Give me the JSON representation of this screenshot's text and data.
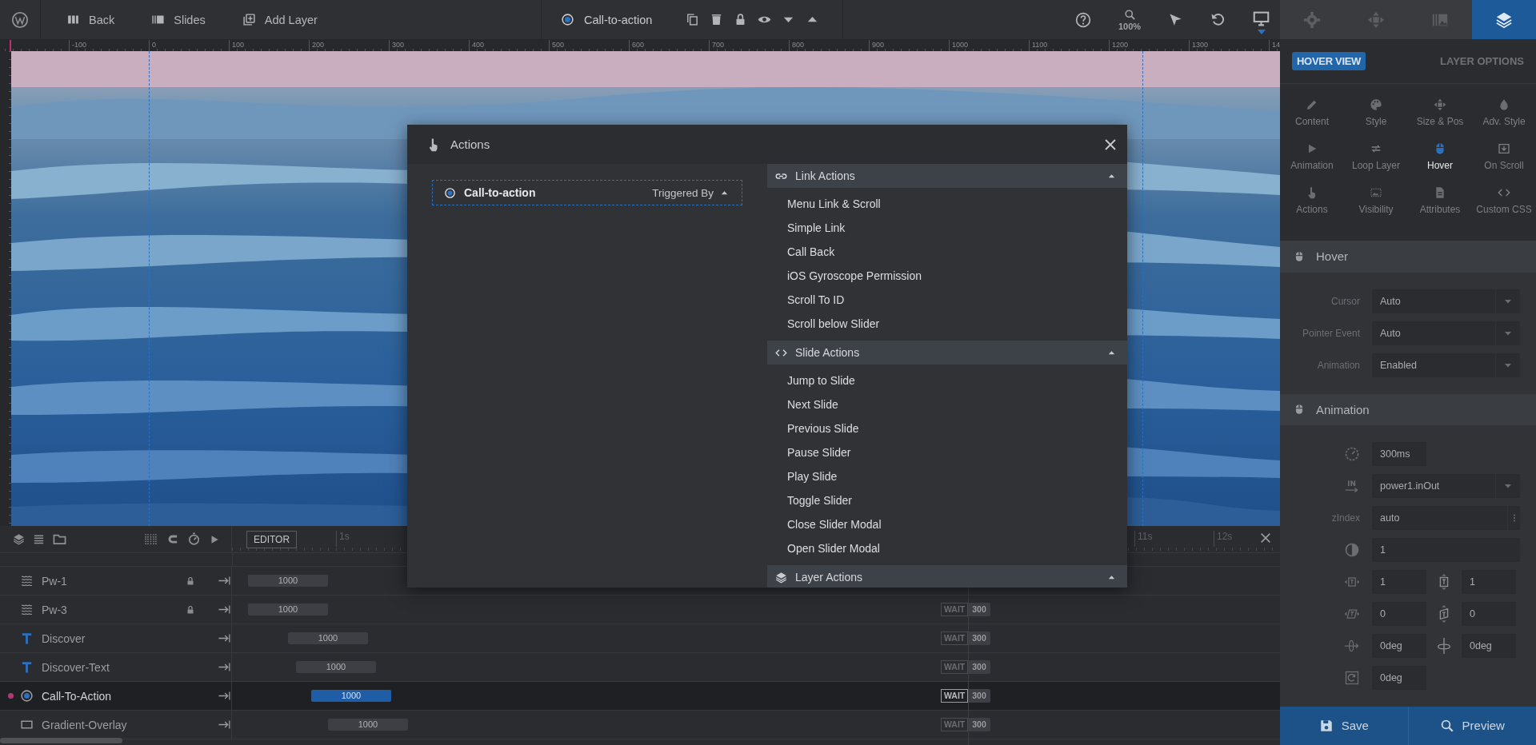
{
  "toolbar": {
    "nav": [
      {
        "label": "Back"
      },
      {
        "label": "Slides"
      },
      {
        "label": "Add Layer"
      }
    ],
    "layer": {
      "label": "Call-to-action"
    },
    "zoom": "100%"
  },
  "ruler": [
    "-100",
    "0",
    "100",
    "200",
    "300",
    "400",
    "500",
    "600",
    "700",
    "800",
    "900",
    "1000",
    "1100",
    "1200",
    "1300",
    "14"
  ],
  "modal": {
    "title": "Actions",
    "trigger": {
      "label": "Call-to-action",
      "button": "Triggered By",
      "expanded": true
    },
    "groups": [
      {
        "title": "Link Actions",
        "expanded": true,
        "items": [
          "Menu Link & Scroll",
          "Simple Link",
          "Call Back",
          "iOS Gyroscope Permission",
          "Scroll To ID",
          "Scroll below Slider"
        ]
      },
      {
        "title": "Slide Actions",
        "expanded": true,
        "items": [
          "Jump to Slide",
          "Next Slide",
          "Previous Slide",
          "Pause Slider",
          "Play Slide",
          "Toggle Slider",
          "Close Slider Modal",
          "Open Slider Modal"
        ]
      },
      {
        "title": "Layer Actions",
        "expanded": true
      }
    ]
  },
  "timeline": {
    "mode": "EDITOR",
    "ticks": [
      "1s",
      "11s",
      "12s"
    ],
    "layers": [
      {
        "name": "Pw-1",
        "kind": "waves",
        "locked": true,
        "selected": false,
        "bar": "1000"
      },
      {
        "name": "Pw-3",
        "kind": "waves",
        "locked": true,
        "selected": false,
        "bar": "1000",
        "wait": {
          "label": "WAIT",
          "value": "300"
        }
      },
      {
        "name": "Discover",
        "kind": "text",
        "locked": false,
        "selected": false,
        "bar": "1000",
        "wait": {
          "label": "WAIT",
          "value": "300"
        }
      },
      {
        "name": "Discover-Text",
        "kind": "text",
        "locked": false,
        "selected": false,
        "bar": "1000",
        "wait": {
          "label": "WAIT",
          "value": "300"
        }
      },
      {
        "name": "Call-To-Action",
        "kind": "button",
        "locked": false,
        "selected": true,
        "bar": "1000",
        "wait": {
          "label": "WAIT",
          "value": "300"
        }
      },
      {
        "name": "Gradient-Overlay",
        "kind": "box",
        "locked": false,
        "selected": false,
        "bar": "1000",
        "wait": {
          "label": "WAIT",
          "value": "300"
        }
      }
    ]
  },
  "panel": {
    "tabs": [
      {
        "selected": false
      },
      {
        "selected": false
      },
      {
        "selected": false
      },
      {
        "selected": true
      }
    ],
    "view_badge": "HOVER VIEW",
    "heading": "LAYER OPTIONS",
    "options": [
      {
        "label": "Content",
        "selected": false
      },
      {
        "label": "Style",
        "selected": false
      },
      {
        "label": "Size & Pos",
        "selected": false
      },
      {
        "label": "Adv. Style",
        "selected": false
      },
      {
        "label": "Animation",
        "selected": false
      },
      {
        "label": "Loop Layer",
        "selected": false
      },
      {
        "label": "Hover",
        "selected": true
      },
      {
        "label": "On Scroll",
        "selected": false
      },
      {
        "label": "Actions",
        "selected": false
      },
      {
        "label": "Visibility",
        "selected": false
      },
      {
        "label": "Attributes",
        "selected": false
      },
      {
        "label": "Custom CSS",
        "selected": false
      }
    ],
    "sections": [
      {
        "title": "Hover",
        "fields": [
          {
            "kind": "select",
            "label": "Cursor",
            "value": "Auto"
          },
          {
            "kind": "select",
            "label": "Pointer Event",
            "value": "Auto"
          },
          {
            "kind": "select",
            "label": "Animation",
            "value": "Enabled"
          }
        ]
      },
      {
        "title": "Animation",
        "fields": [
          {
            "kind": "short",
            "value": "300ms"
          },
          {
            "kind": "select",
            "value": "power1.inOut"
          },
          {
            "kind": "menu",
            "label": "zIndex",
            "value": "auto"
          },
          {
            "kind": "wide",
            "value": "1"
          },
          {
            "kind": "pair",
            "values": [
              "1",
              "1"
            ]
          },
          {
            "kind": "pair",
            "values": [
              "0",
              "0"
            ]
          },
          {
            "kind": "pair",
            "values": [
              "0deg",
              "0deg"
            ]
          },
          {
            "kind": "short",
            "value": "0deg"
          }
        ]
      }
    ],
    "buttons": [
      {
        "label": "Save"
      },
      {
        "label": "Preview"
      }
    ]
  }
}
